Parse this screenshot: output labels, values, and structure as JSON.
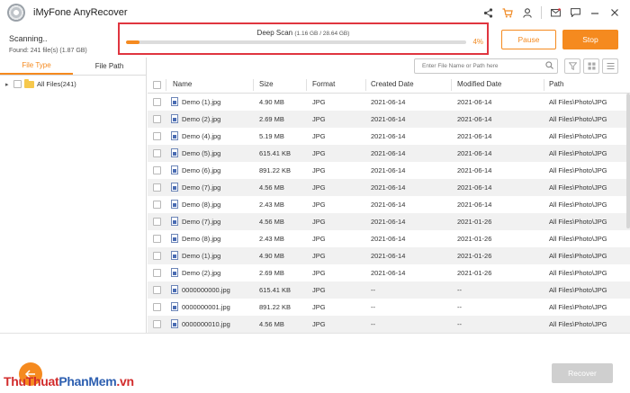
{
  "app": {
    "title": "iMyFone AnyRecover"
  },
  "toolbar_icons": [
    "share-icon",
    "cart-icon",
    "user-icon",
    "mail-icon",
    "feedback-icon",
    "minimize-icon",
    "close-icon"
  ],
  "scan": {
    "status": "Scanning..",
    "found": "Found: 241 file(s) (1.87 GB)",
    "mode": "Deep Scan",
    "size": "(1.16 GB / 28.64 GB)",
    "percent": "4%",
    "progress": 0.04,
    "pause_label": "Pause",
    "stop_label": "Stop"
  },
  "colors": {
    "accent": "#f58a1f",
    "highlight_border": "#e0353f",
    "recover_disabled": "#cfcfcf"
  },
  "left_panel": {
    "tabs": [
      "File Type",
      "File Path"
    ],
    "active_tab": "File Type",
    "tree_item": "All Files(241)"
  },
  "search": {
    "placeholder": "Enter File Name or Path here"
  },
  "table": {
    "columns": [
      "Name",
      "Size",
      "Format",
      "Created Date",
      "Modified Date",
      "Path"
    ],
    "rows": [
      [
        "Demo (1).jpg",
        "4.90 MB",
        "JPG",
        "2021-06-14",
        "2021-06-14",
        "All Files\\Photo\\JPG"
      ],
      [
        "Demo (2).jpg",
        "2.69 MB",
        "JPG",
        "2021-06-14",
        "2021-06-14",
        "All Files\\Photo\\JPG"
      ],
      [
        "Demo (4).jpg",
        "5.19 MB",
        "JPG",
        "2021-06-14",
        "2021-06-14",
        "All Files\\Photo\\JPG"
      ],
      [
        "Demo (5).jpg",
        "615.41 KB",
        "JPG",
        "2021-06-14",
        "2021-06-14",
        "All Files\\Photo\\JPG"
      ],
      [
        "Demo (6).jpg",
        "891.22 KB",
        "JPG",
        "2021-06-14",
        "2021-06-14",
        "All Files\\Photo\\JPG"
      ],
      [
        "Demo (7).jpg",
        "4.56 MB",
        "JPG",
        "2021-06-14",
        "2021-06-14",
        "All Files\\Photo\\JPG"
      ],
      [
        "Demo (8).jpg",
        "2.43 MB",
        "JPG",
        "2021-06-14",
        "2021-06-14",
        "All Files\\Photo\\JPG"
      ],
      [
        "Demo (7).jpg",
        "4.56 MB",
        "JPG",
        "2021-06-14",
        "2021-01-26",
        "All Files\\Photo\\JPG"
      ],
      [
        "Demo (8).jpg",
        "2.43 MB",
        "JPG",
        "2021-06-14",
        "2021-01-26",
        "All Files\\Photo\\JPG"
      ],
      [
        "Demo (1).jpg",
        "4.90 MB",
        "JPG",
        "2021-06-14",
        "2021-01-26",
        "All Files\\Photo\\JPG"
      ],
      [
        "Demo (2).jpg",
        "2.69 MB",
        "JPG",
        "2021-06-14",
        "2021-01-26",
        "All Files\\Photo\\JPG"
      ],
      [
        "0000000000.jpg",
        "615.41 KB",
        "JPG",
        "--",
        "--",
        "All Files\\Photo\\JPG"
      ],
      [
        "0000000001.jpg",
        "891.22 KB",
        "JPG",
        "--",
        "--",
        "All Files\\Photo\\JPG"
      ],
      [
        "0000000010.jpg",
        "4.56 MB",
        "JPG",
        "--",
        "--",
        "All Files\\Photo\\JPG"
      ]
    ]
  },
  "footer": {
    "recover_label": "Recover"
  },
  "watermark": {
    "part1": "ThuThuat",
    "part2": "PhanMem",
    "part3": ".vn"
  }
}
